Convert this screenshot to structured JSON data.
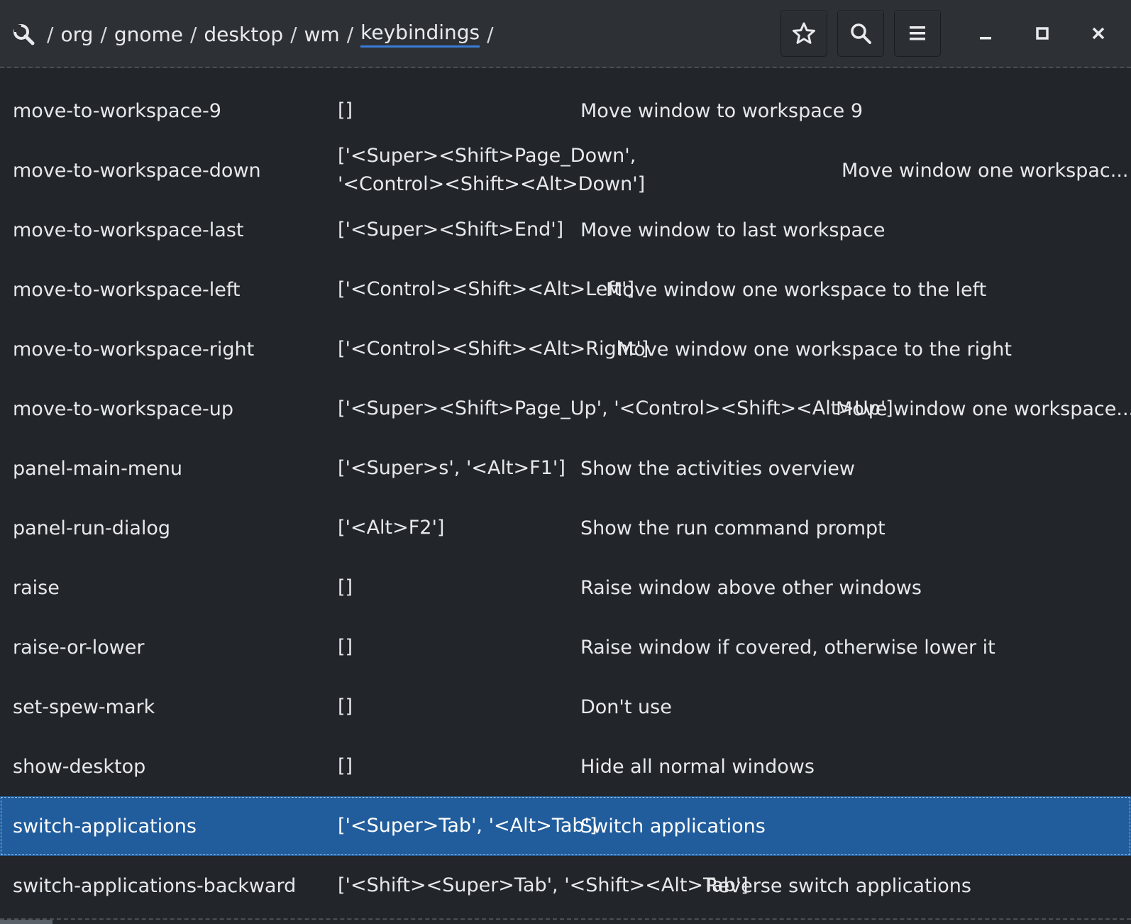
{
  "path": {
    "segments": [
      "org",
      "gnome",
      "desktop",
      "wm",
      "keybindings"
    ],
    "separator": "/"
  },
  "toolbar": {
    "bookmark_icon": "star-icon",
    "search_icon": "search-icon",
    "menu_icon": "hamburger-menu-icon"
  },
  "window": {
    "minimize_icon": "minimize-icon",
    "maximize_icon": "maximize-icon",
    "close_icon": "close-icon"
  },
  "colors": {
    "selected_bg": "#215d9c",
    "accent": "#3a7bd5",
    "bg": "#22262b"
  },
  "rows": [
    {
      "key": "move-to-workspace-9",
      "value": "[]",
      "desc": "Move window to workspace 9"
    },
    {
      "key": "move-to-workspace-down",
      "value_line1": "['<Super><Shift>Page_Down',",
      "value_line2": "'<Control><Shift><Alt>Down']",
      "desc": "Move window one workspac..."
    },
    {
      "key": "move-to-workspace-last",
      "value": "['<Super><Shift>End']",
      "desc": "Move window to last workspace"
    },
    {
      "key": "move-to-workspace-left",
      "value": "['<Control><Shift><Alt>Left']",
      "desc": "Move window one workspace to the left"
    },
    {
      "key": "move-to-workspace-right",
      "value": "['<Control><Shift><Alt>Right']",
      "desc": "Move window one workspace to the right"
    },
    {
      "key": "move-to-workspace-up",
      "value": "['<Super><Shift>Page_Up', '<Control><Shift><Alt>Up']",
      "desc": "Move window one workspace..."
    },
    {
      "key": "panel-main-menu",
      "value": "['<Super>s', '<Alt>F1']",
      "desc": "Show the activities overview"
    },
    {
      "key": "panel-run-dialog",
      "value": "['<Alt>F2']",
      "desc": "Show the run command prompt"
    },
    {
      "key": "raise",
      "value": "[]",
      "desc": "Raise window above other windows"
    },
    {
      "key": "raise-or-lower",
      "value": "[]",
      "desc": "Raise window if covered, otherwise lower it"
    },
    {
      "key": "set-spew-mark",
      "value": "[]",
      "desc": "Don't use"
    },
    {
      "key": "show-desktop",
      "value": "[]",
      "desc": "Hide all normal windows"
    },
    {
      "key": "switch-applications",
      "value": "['<Super>Tab', '<Alt>Tab']",
      "desc": "Switch applications",
      "selected": true
    },
    {
      "key": "switch-applications-backward",
      "value": "['<Shift><Super>Tab', '<Shift><Alt>Tab']",
      "desc": "Reverse switch applications"
    }
  ]
}
